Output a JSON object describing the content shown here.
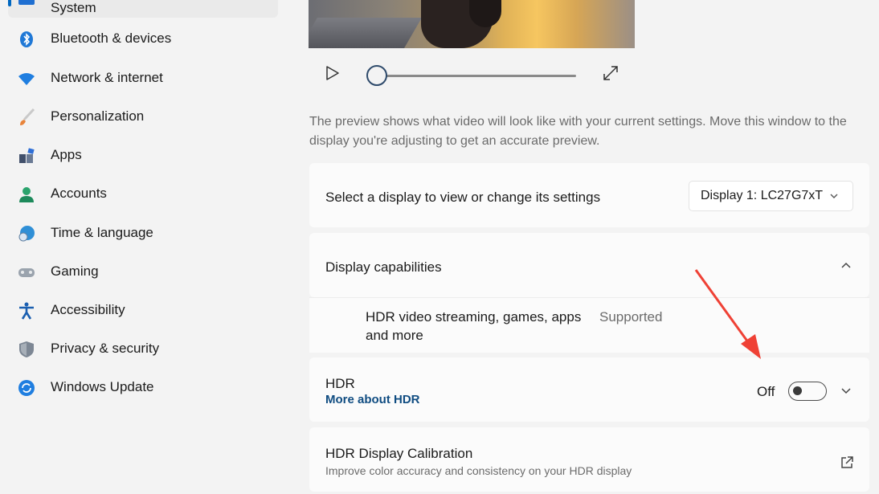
{
  "sidebar": {
    "items": [
      {
        "label": "System",
        "icon": "monitor-icon",
        "selected": true
      },
      {
        "label": "Bluetooth & devices",
        "icon": "bluetooth-icon"
      },
      {
        "label": "Network & internet",
        "icon": "wifi-icon"
      },
      {
        "label": "Personalization",
        "icon": "brush-icon"
      },
      {
        "label": "Apps",
        "icon": "apps-icon"
      },
      {
        "label": "Accounts",
        "icon": "person-icon"
      },
      {
        "label": "Time & language",
        "icon": "globe-clock-icon"
      },
      {
        "label": "Gaming",
        "icon": "gamepad-icon"
      },
      {
        "label": "Accessibility",
        "icon": "accessibility-icon"
      },
      {
        "label": "Privacy & security",
        "icon": "shield-icon"
      },
      {
        "label": "Windows Update",
        "icon": "update-icon"
      }
    ]
  },
  "main": {
    "preview_note": "The preview shows what video will look like with your current settings. Move this window to the display you're adjusting to get an accurate preview.",
    "display_select": {
      "label": "Select a display to view or change its settings",
      "value": "Display 1: LC27G7xT"
    },
    "capabilities": {
      "title": "Display capabilities",
      "feature": "HDR video streaming, games, apps and more",
      "status": "Supported"
    },
    "hdr": {
      "title": "HDR",
      "link": "More about HDR",
      "state_label": "Off",
      "enabled": false
    },
    "calibration": {
      "title": "HDR Display Calibration",
      "description": "Improve color accuracy and consistency on your HDR display"
    }
  },
  "colors": {
    "accent": "#0067c0",
    "link": "#0f4c81",
    "annotation_arrow": "#ef4135"
  }
}
